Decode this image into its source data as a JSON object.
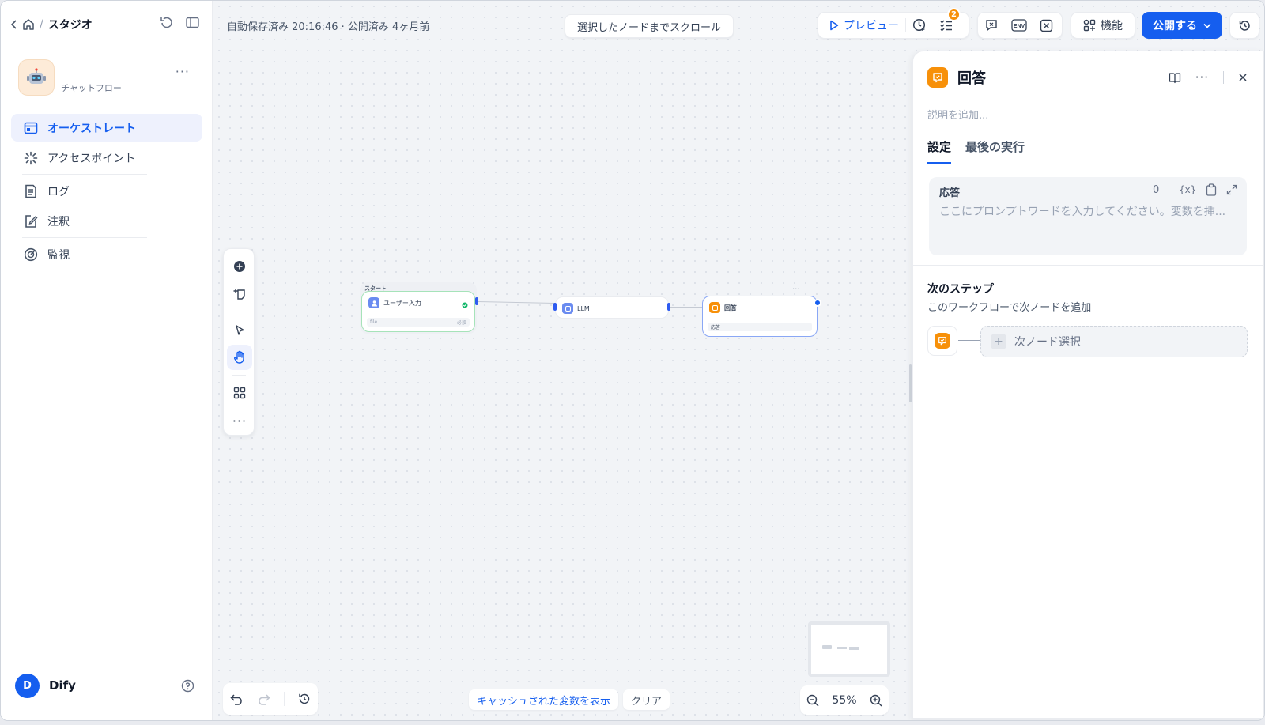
{
  "sidebar": {
    "breadcrumb_title": "スタジオ",
    "app_type": "チャットフロー",
    "nav": [
      {
        "label": "オーケストレート",
        "icon": "orchestrate-icon",
        "active": true
      },
      {
        "label": "アクセスポイント",
        "icon": "access-point-icon"
      },
      {
        "label": "ログ",
        "icon": "log-icon"
      },
      {
        "label": "注釈",
        "icon": "annotation-icon"
      },
      {
        "label": "監視",
        "icon": "monitor-icon"
      }
    ],
    "user": {
      "initial": "D",
      "name": "Dify"
    }
  },
  "canvas": {
    "status": "自動保存済み 20:16:46 · 公開済み 4ヶ月前",
    "scroll_to_node": "選択したノードまでスクロール",
    "preview_label": "プレビュー",
    "checklist_badge": "2",
    "features_label": "機能",
    "publish_label": "公開する",
    "env_label": "ENV",
    "zoom": "55%",
    "show_cached": "キャッシュされた変数を表示",
    "clear": "クリア",
    "nodes": {
      "start_group": "スタート",
      "start_title": "ユーザー入力",
      "start_var": "file",
      "start_var_req": "必須",
      "llm_title": "LLM",
      "answer_title": "回答",
      "answer_row": "応答"
    }
  },
  "panel": {
    "title": "回答",
    "description_placeholder": "説明を追加...",
    "tabs": [
      "設定",
      "最後の実行"
    ],
    "response_label": "応答",
    "response_count": "0",
    "response_var_icon": "{x}",
    "response_placeholder": "ここにプロンプトワードを入力してください。変数を挿...",
    "next_step_title": "次のステップ",
    "next_step_sub": "このワークフローで次ノードを追加",
    "next_node_select": "次ノード選択"
  },
  "colors": {
    "accent": "#155eef",
    "answer_node": "#f79009",
    "start_border": "#a6e3b9"
  }
}
